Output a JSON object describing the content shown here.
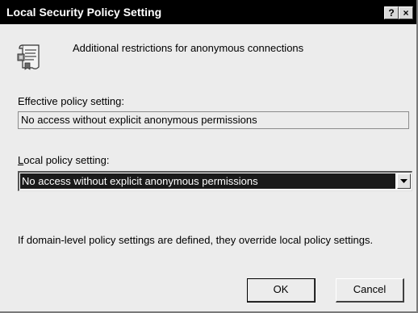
{
  "window": {
    "title": "Local Security Policy Setting",
    "help_label": "?",
    "close_label": "×"
  },
  "header": {
    "icon": "policy-document-icon",
    "description": "Additional restrictions for anonymous connections"
  },
  "effective": {
    "label": "Effective policy setting:",
    "value": "No access without explicit anonymous permissions"
  },
  "local": {
    "label_underline": "L",
    "label_rest": "ocal policy setting:",
    "selected": "No access without explicit anonymous permissions"
  },
  "note": "If domain-level policy settings are defined, they override local policy settings.",
  "buttons": {
    "ok": "OK",
    "cancel": "Cancel"
  },
  "colors": {
    "titlebar": "#000000",
    "dialog_bg": "#ececec",
    "selection_bg": "#1a1a1a"
  }
}
